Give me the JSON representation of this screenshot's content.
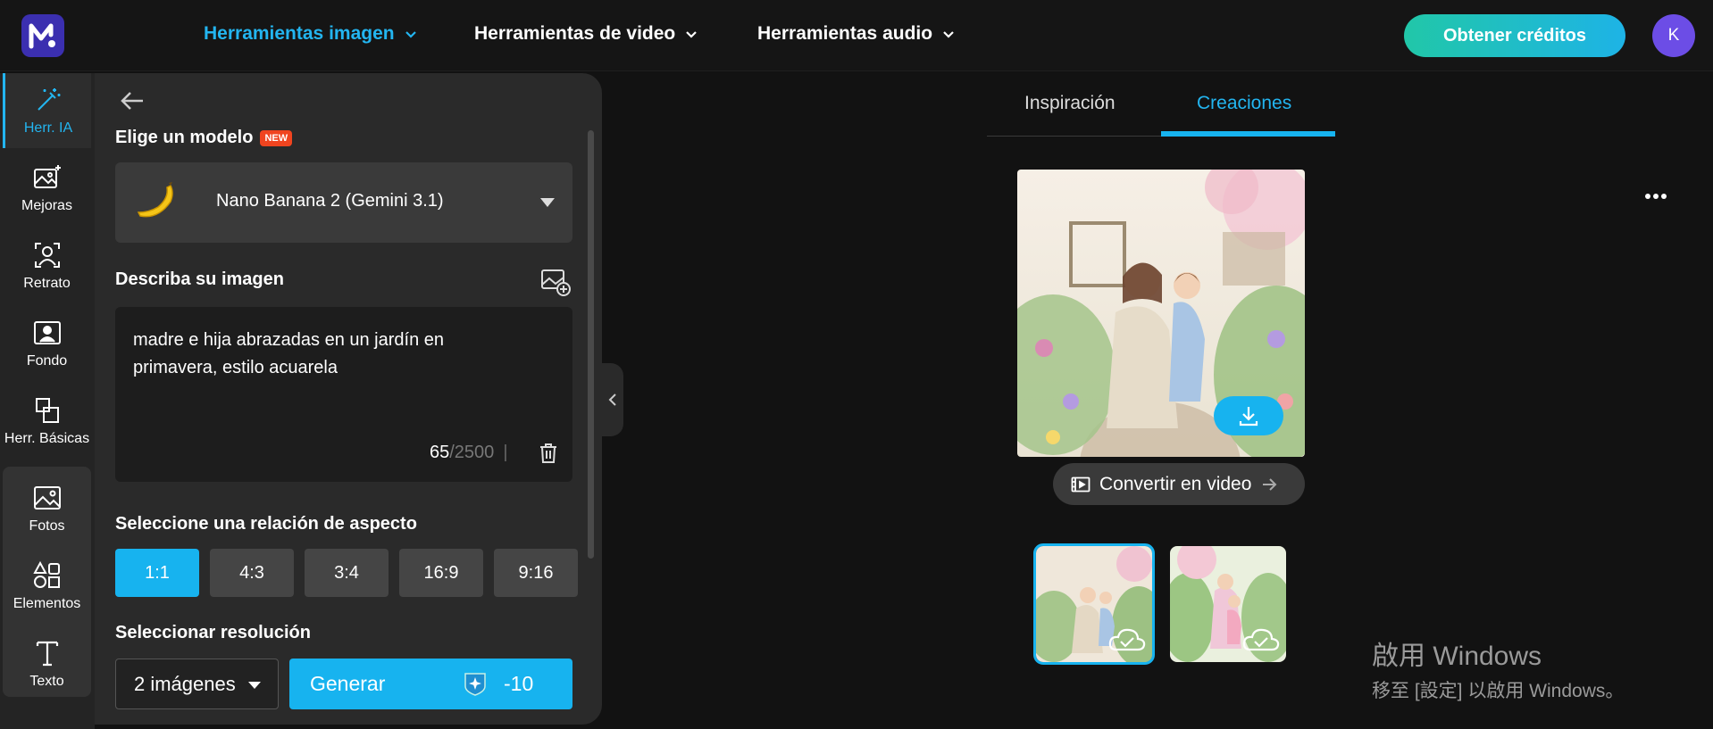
{
  "brand": {
    "accent": "#17b3ef",
    "logo_bg": "#3b2fb0",
    "credits_gradient": [
      "#21c7a8",
      "#1eb3e6"
    ]
  },
  "nav": {
    "items": [
      {
        "label": "Herramientas imagen",
        "active": true
      },
      {
        "label": "Herramientas de video",
        "active": false
      },
      {
        "label": "Herramientas audio",
        "active": false
      }
    ],
    "credits_label": "Obtener créditos",
    "avatar_initial": "K"
  },
  "rail": {
    "items": [
      {
        "label": "Herr. IA",
        "icon": "magic-wand-icon",
        "active": true
      },
      {
        "label": "Mejoras",
        "icon": "image-sparkle-icon"
      },
      {
        "label": "Retrato",
        "icon": "portrait-icon"
      },
      {
        "label": "Fondo",
        "icon": "background-icon"
      },
      {
        "label": "Herr. Básicas",
        "icon": "basic-tools-icon"
      },
      {
        "label": "Fotos",
        "icon": "photos-icon"
      },
      {
        "label": "Elementos",
        "icon": "elements-icon"
      },
      {
        "label": "Texto",
        "icon": "text-icon"
      }
    ]
  },
  "panel": {
    "model_label": "Elige un modelo",
    "new_badge": "NEW",
    "model_name": "Nano Banana 2 (Gemini 3.1)",
    "describe_label": "Describa su imagen",
    "prompt": "madre e hija abrazadas en un jardín en primavera, estilo acuarela",
    "char_count": "65",
    "char_max": "/2500",
    "separator": "|",
    "aspect_label": "Seleccione una relación de aspecto",
    "aspect_ratios": [
      {
        "label": "1:1",
        "active": true
      },
      {
        "label": "4:3",
        "active": false
      },
      {
        "label": "3:4",
        "active": false
      },
      {
        "label": "16:9",
        "active": false
      },
      {
        "label": "9:16",
        "active": false
      }
    ],
    "resolution_label": "Seleccionar resolución",
    "image_count": "2 imágenes",
    "generate_label": "Generar",
    "generate_cost": "-10"
  },
  "right": {
    "tabs": [
      {
        "label": "Inspiración",
        "active": false
      },
      {
        "label": "Creaciones",
        "active": true
      }
    ],
    "convert_label": "Convertir en video"
  },
  "watermark": {
    "line1": "啟用 Windows",
    "line2": "移至 [設定] 以啟用 Windows。"
  }
}
